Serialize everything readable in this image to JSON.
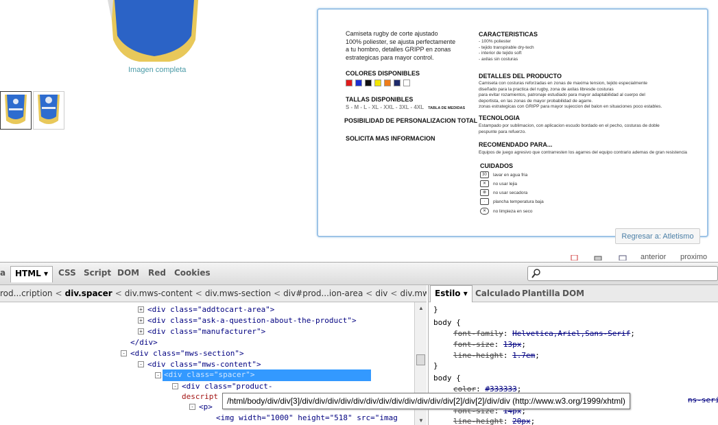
{
  "page": {
    "full_image_link": "Imagen completa",
    "product_sheet": {
      "intro": [
        "Camiseta rugby de corte ajustado",
        "100% poliester, se ajusta perfectamente",
        "a tu hombro, detalles GRIPP en zonas",
        "estrategicas para mayor control."
      ],
      "colores_heading": "COLORES DISPONIBLES",
      "colors": [
        "#e01b1b",
        "#1a2fd1",
        "#111111",
        "#f2e600",
        "#ef7d1a",
        "#1d2a6b",
        "#ffffff"
      ],
      "tallas_heading": "TALLAS DISPONIBLES",
      "sizes": "S - M - L - XL - XXL - 3XL - 4XL",
      "size_table": "TABLA DE MEDIDAS",
      "personalizacion": "POSIBILIDAD DE PERSONALIZACION TOTAL",
      "info": "SOLICITA MAS INFORMACION",
      "caracteristicas_heading": "CARACTERISTICAS",
      "caracteristicas": [
        "- 100% poliester",
        "- tejido transpirable dry-tech",
        "- interior de tejido soft",
        "- axilas sin costuras"
      ],
      "detalles_heading": "DETALLES DEL PRODUCTO",
      "detalles": [
        "Camiseta con costuras reforzadas en zonas de maxima tension, tejido especialmente",
        "diseñado para la practica del rugby, zona de axilas libresde costuras",
        "para evitar rozamientos, patronaje estudiado para mayor adaptabilidad al cuerpo del",
        "deportista, en las zonas de mayor probabilidad de agarre.",
        "zonas estrategicas con GRIPP para mayor sujeccion del balon en situaciones poco estables."
      ],
      "tecnologia_heading": "TECNOLOGIA",
      "tecnologia": [
        "Estampado por sublimacion, con aplicacion escudo bordado en el pecho, costuras de doble",
        "pespunte para refuerzo."
      ],
      "recomendado_heading": "RECOMENDADO PARA...",
      "recomendado": "Equipos de juego agresivo que contrarresten los agarres  del equipo contrario ademas de gran resistencia",
      "cuidados_heading": "CUIDADOS",
      "cuidados": [
        "lavar en agua fria",
        "no usar lejia",
        "no usar secadora",
        "plancha temperatura baja",
        "no limpieza en seco"
      ]
    },
    "back_button": "Regresar a: Atletismo",
    "prev": "anterior",
    "next": "proximo"
  },
  "firebug": {
    "tabs": [
      "a",
      "HTML",
      "CSS",
      "Script",
      "DOM",
      "Red",
      "Cookies"
    ],
    "active_tab": "HTML",
    "breadcrumbs": [
      "rod...cription",
      "div.spacer",
      "div.mws-content",
      "div.mws-section",
      "div#prod...ion-area",
      "div",
      "div.mws-c"
    ],
    "html_lines": [
      {
        "tw": "+",
        "text": "<div class=\"addtocart-area\">"
      },
      {
        "tw": "+",
        "text": "<div class=\"ask-a-question-about-the-product\">"
      },
      {
        "tw": "+",
        "text": "<div class=\"manufacturer\">"
      },
      {
        "tw": "",
        "text": "</div>"
      },
      {
        "tw": "-",
        "text": "<div class=\"mws-section\">"
      },
      {
        "tw": "-",
        "text": "<div class=\"mws-content\">"
      },
      {
        "tw": "-",
        "text": "<div class=\"spacer\">"
      },
      {
        "tw": "-",
        "text": "<div class=\"product-"
      },
      {
        "tw": "",
        "text": "descript"
      },
      {
        "tw": "-",
        "text": "<p>"
      },
      {
        "tw": "",
        "text": "<img width=\"1000\" height=\"518\" src=\"imag"
      }
    ],
    "side_tabs": [
      "Estilo",
      "Calculado",
      "Plantilla",
      "DOM"
    ],
    "css_lines": [
      {
        "t": "}"
      },
      {
        "t": "body {"
      },
      {
        "p": "font-family",
        "v": "Helvetica,Ariel,Sans-Serif"
      },
      {
        "p": "font-size",
        "v": "13px"
      },
      {
        "p": "line-height",
        "v": "1.7em"
      },
      {
        "t": "}"
      },
      {
        "t": "body {"
      },
      {
        "p": "color",
        "v": "#333333"
      },
      {
        "p": "font-size",
        "v": "14px"
      },
      {
        "p": "line-height",
        "v": "20px"
      }
    ],
    "css_overflow_text": "ns-seri",
    "xpath_tooltip": "/html/body/div/div[3]/div/div/div/div/div/div/div/div/div/div/div/div[2]/div[2]/div/div (http://www.w3.org/1999/xhtml)"
  }
}
